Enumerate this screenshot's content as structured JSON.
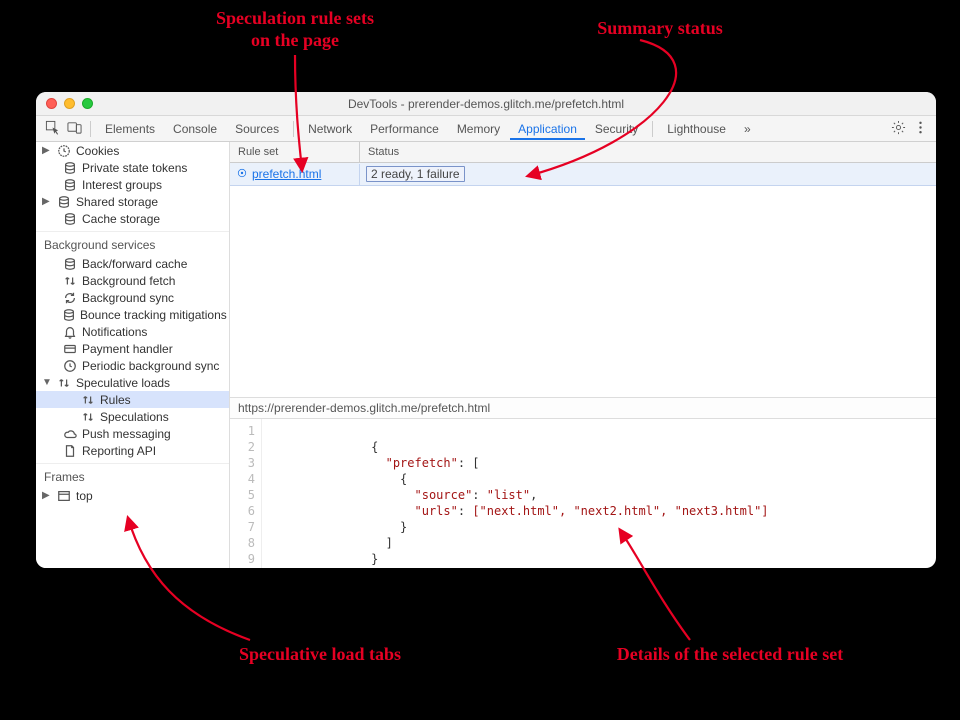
{
  "annotations": {
    "rule_sets": "Speculation rule sets\non the page",
    "summary_status": "Summary status",
    "speculative_tabs": "Speculative load tabs",
    "details": "Details of the selected rule set"
  },
  "window": {
    "title": "DevTools - prerender-demos.glitch.me/prefetch.html"
  },
  "tabs": {
    "items": [
      "Elements",
      "Console",
      "Sources",
      "Network",
      "Performance",
      "Memory",
      "Application",
      "Security",
      "Lighthouse"
    ],
    "active": "Application",
    "more": "»"
  },
  "sidebar": {
    "section1": [
      {
        "label": "Cookies",
        "icon": "clock",
        "expand": true
      },
      {
        "label": "Private state tokens",
        "icon": "db"
      },
      {
        "label": "Interest groups",
        "icon": "db"
      },
      {
        "label": "Shared storage",
        "icon": "db",
        "expand": true
      },
      {
        "label": "Cache storage",
        "icon": "db"
      }
    ],
    "heading_bg": "Background services",
    "bg": [
      {
        "label": "Back/forward cache",
        "icon": "db"
      },
      {
        "label": "Background fetch",
        "icon": "updown"
      },
      {
        "label": "Background sync",
        "icon": "sync"
      },
      {
        "label": "Bounce tracking mitigations",
        "icon": "db"
      },
      {
        "label": "Notifications",
        "icon": "bell"
      },
      {
        "label": "Payment handler",
        "icon": "card"
      },
      {
        "label": "Periodic background sync",
        "icon": "clock"
      }
    ],
    "spec": {
      "label": "Speculative loads",
      "children": [
        {
          "label": "Rules",
          "icon": "updown"
        },
        {
          "label": "Speculations",
          "icon": "updown"
        }
      ]
    },
    "after": [
      {
        "label": "Push messaging",
        "icon": "cloud"
      },
      {
        "label": "Reporting API",
        "icon": "doc"
      }
    ],
    "heading_frames": "Frames",
    "frames": [
      {
        "label": "top",
        "icon": "frame",
        "expand": true
      }
    ]
  },
  "table": {
    "col_ruleset": "Rule set",
    "col_status": "Status",
    "row": {
      "ruleset": "prefetch.html",
      "status": "2 ready, 1 failure"
    }
  },
  "pathbar": "https://prerender-demos.glitch.me/prefetch.html",
  "code": {
    "lines": 9,
    "l2": "{",
    "l3_k": "\"prefetch\"",
    "l3_r": ": [",
    "l4": "{",
    "l5_k": "\"source\"",
    "l5_v": "\"list\"",
    "l6_k": "\"urls\"",
    "l6_v": "[\"next.html\", \"next2.html\", \"next3.html\"]",
    "l7": "}",
    "l8": "]",
    "l9": "}"
  }
}
